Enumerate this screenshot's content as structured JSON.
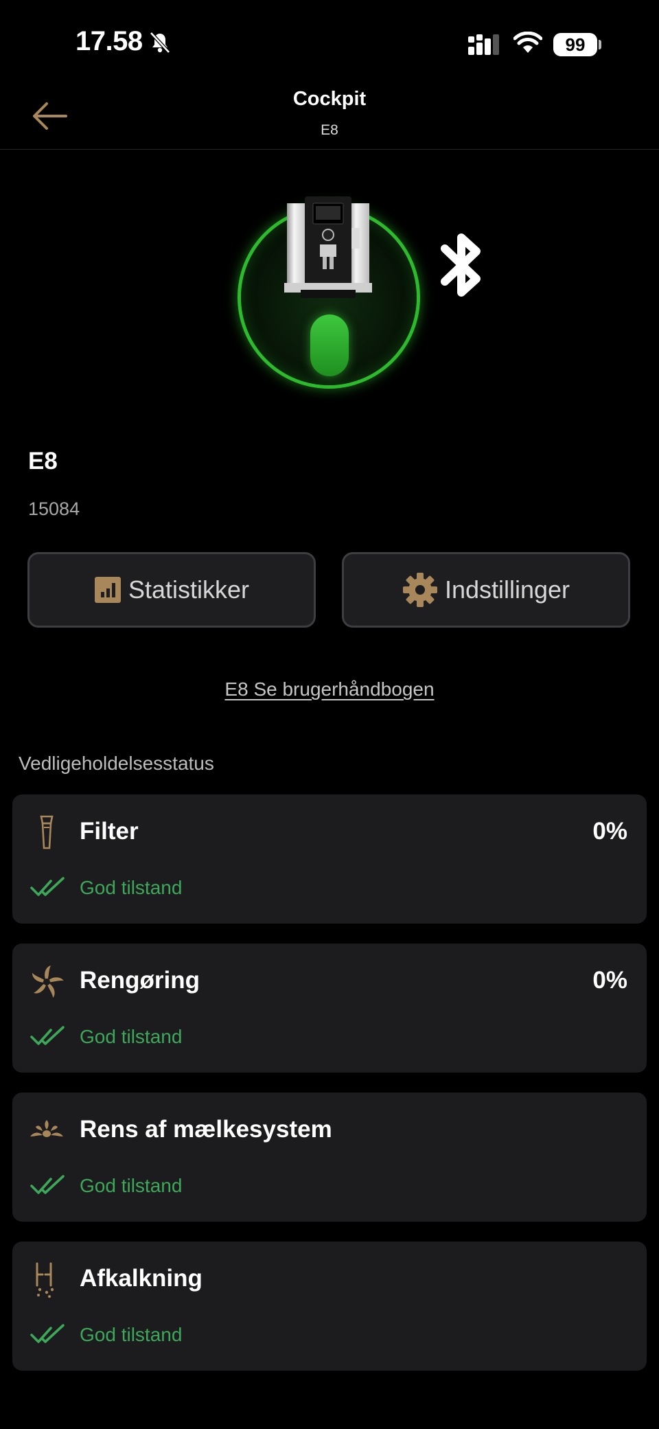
{
  "status_bar": {
    "time": "17.58",
    "battery": "99",
    "icons": [
      "bell-slash-icon",
      "cellular-signal-icon",
      "wifi-icon",
      "battery-icon"
    ]
  },
  "header": {
    "title": "Cockpit",
    "subtitle": "E8",
    "back_icon": "arrow-left-icon"
  },
  "device": {
    "name": "E8",
    "serial": "15084",
    "connection_icon": "bluetooth-icon"
  },
  "actions": {
    "statistics_label": "Statistikker",
    "settings_label": "Indstillinger"
  },
  "manual_link": "E8 Se brugerhåndbogen",
  "maintenance": {
    "title": "Vedligeholdelsesstatus",
    "items": [
      {
        "title": "Filter",
        "percent": "0%",
        "status": "God tilstand",
        "icon": "filter-icon"
      },
      {
        "title": "Rengøring",
        "percent": "0%",
        "status": "God tilstand",
        "icon": "cleaning-icon"
      },
      {
        "title": "Rens af mælkesystem",
        "status": "God tilstand",
        "icon": "milk-system-icon"
      },
      {
        "title": "Afkalkning",
        "status": "God tilstand",
        "icon": "descaling-icon"
      }
    ]
  },
  "colors": {
    "background": "#000000",
    "card": "#1c1c1e",
    "accent_gold": "#a8875a",
    "status_green": "#3ea85a",
    "ring_green": "#2dbb2d"
  }
}
